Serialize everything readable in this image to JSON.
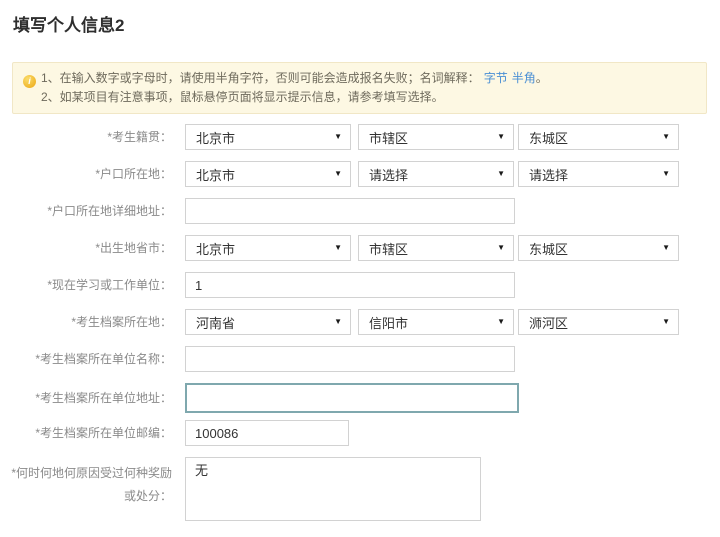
{
  "page": {
    "title": "填写个人信息2"
  },
  "notice": {
    "icon_glyph": "i",
    "line1_text": "1、在输入数字或字母时，请使用半角字符，否则可能会造成报名失败；名词解释：",
    "link1": "字节",
    "link2": "半角",
    "line1_suffix": "。",
    "line2_text": "2、如某项目有注意事项，鼠标悬停页面将显示提示信息，请参考填写选择。"
  },
  "form": {
    "rows": [
      {
        "label": "*考生籍贯：",
        "type": "selects",
        "fields": [
          {
            "value": "北京市"
          },
          {
            "value": "市辖区"
          },
          {
            "value": "东城区"
          }
        ]
      },
      {
        "label": "*户口所在地：",
        "type": "selects",
        "fields": [
          {
            "value": "北京市"
          },
          {
            "value": "请选择"
          },
          {
            "value": "请选择"
          }
        ]
      },
      {
        "label": "*户口所在地详细地址：",
        "type": "text",
        "value": ""
      },
      {
        "label": "*出生地省市：",
        "type": "selects",
        "fields": [
          {
            "value": "北京市"
          },
          {
            "value": "市辖区"
          },
          {
            "value": "东城区"
          }
        ]
      },
      {
        "label": "*现在学习或工作单位：",
        "type": "text",
        "value": "1"
      },
      {
        "label": "*考生档案所在地：",
        "type": "selects",
        "fields": [
          {
            "value": "河南省"
          },
          {
            "value": "信阳市"
          },
          {
            "value": "浉河区"
          }
        ]
      },
      {
        "label": "*考生档案所在单位名称：",
        "type": "text",
        "value": ""
      },
      {
        "label": "*考生档案所在单位地址：",
        "type": "text",
        "value": "",
        "focused": true
      },
      {
        "label": "*考生档案所在单位邮编：",
        "type": "text",
        "value": "100086"
      },
      {
        "label_line1": "*何时何地何原因受过何种奖励",
        "label_line2": "或处分：",
        "type": "textarea",
        "value": "无"
      }
    ]
  },
  "icons": {
    "select_caret": "▼"
  },
  "colors": {
    "notice_bg": "#fdf8e3",
    "notice_border": "#f1e7c6",
    "link_blue": "#4a8fd4",
    "icon_amber": "#eca712",
    "input_border": "#d2d2d2",
    "focus_teal": "#7fa8ae",
    "label_gray": "#8a8a8a",
    "title_color": "#2e2e2e"
  }
}
